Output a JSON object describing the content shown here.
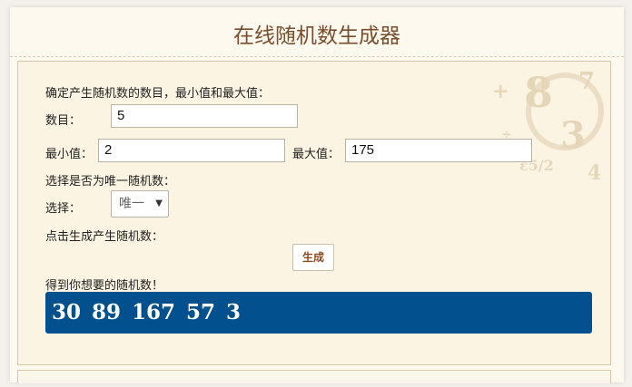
{
  "page": {
    "title": "在线随机数生成器"
  },
  "form": {
    "intro": "确定产生随机数的数目，最小值和最大值：",
    "count_label": "数目：",
    "count_value": "5",
    "min_label": "最小值：",
    "min_value": "2",
    "max_label": "最大值：",
    "max_value": "175",
    "unique_prompt": "选择是否为唯一随机数：",
    "select_label": "选择：",
    "select_value": "唯一",
    "generate_prompt": "点击生成产生随机数：",
    "generate_button": "生成",
    "result_label": "得到你想要的随机数！",
    "result_value": "30 89 167 57 3"
  },
  "colors": {
    "title": "#7a4e2d",
    "panel_bg": "#fcf4e2",
    "result_bg": "#03508f",
    "button_text": "#8a4a22"
  },
  "icons": {
    "select_arrow": "chevron-down-icon",
    "decoration": "numbers-decoration"
  }
}
